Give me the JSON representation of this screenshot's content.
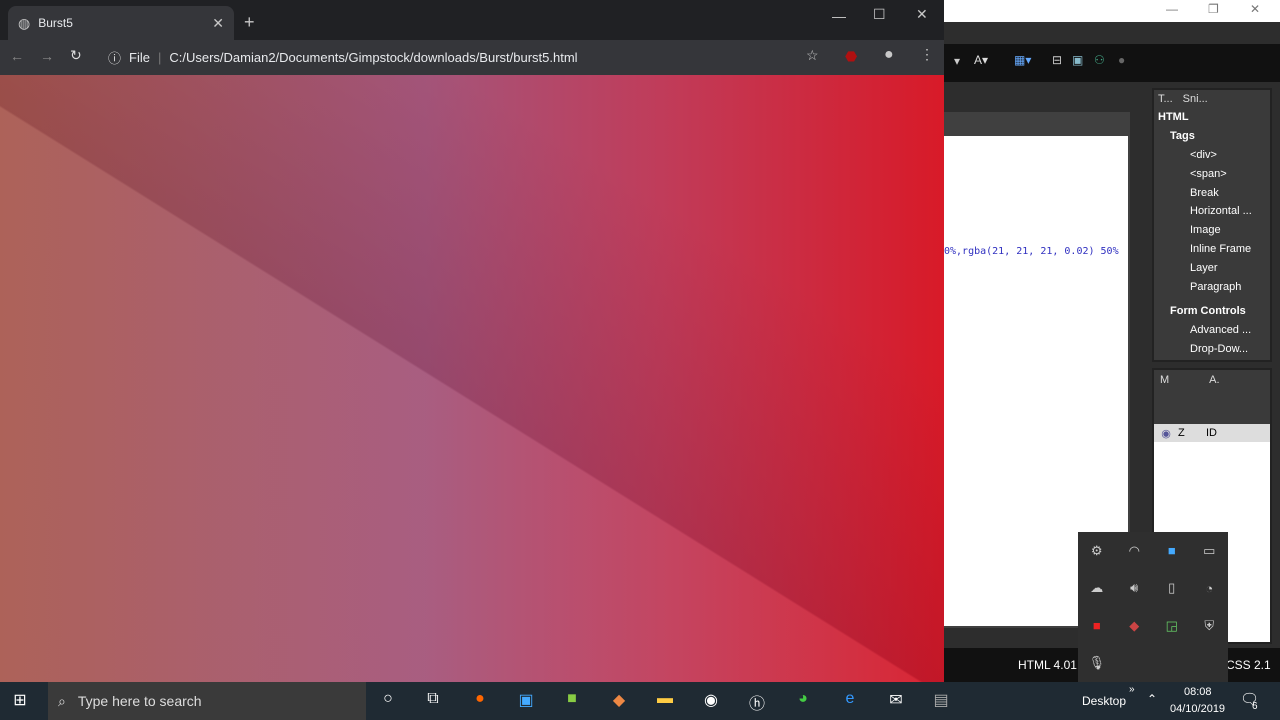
{
  "browser": {
    "tab_title": "Burst5",
    "file_label": "File",
    "url": "C:/Users/Damian2/Documents/Gimpstock/downloads/Burst/burst5.html"
  },
  "editor": {
    "code_line": "0%,rgba(21, 21, 21, 0.02) 50%",
    "panel_tabs": [
      "T...",
      "Sni..."
    ],
    "tree": {
      "html": "HTML",
      "tags": "Tags",
      "items": [
        "<div>",
        "<span>",
        "Break",
        "Horizontal ...",
        "Image",
        "Inline Frame",
        "Layer",
        "Paragraph"
      ],
      "form_controls": "Form Controls",
      "form_items": [
        "Advanced ...",
        "Drop-Dow..."
      ]
    },
    "layers_tabs": [
      "M",
      "A."
    ],
    "layers_columns": [
      "Z",
      "ID"
    ],
    "status": {
      "doctype": "HTML 4.01 T",
      "css": "CSS 2.1"
    }
  },
  "taskbar": {
    "search_placeholder": "Type here to search",
    "desktop": "Desktop",
    "time": "08:08",
    "date": "04/10/2019",
    "notifications": "6"
  },
  "colors": {
    "gradient_left": "#a95a50",
    "gradient_mid": "#a4557a",
    "gradient_right": "#d81a28"
  }
}
